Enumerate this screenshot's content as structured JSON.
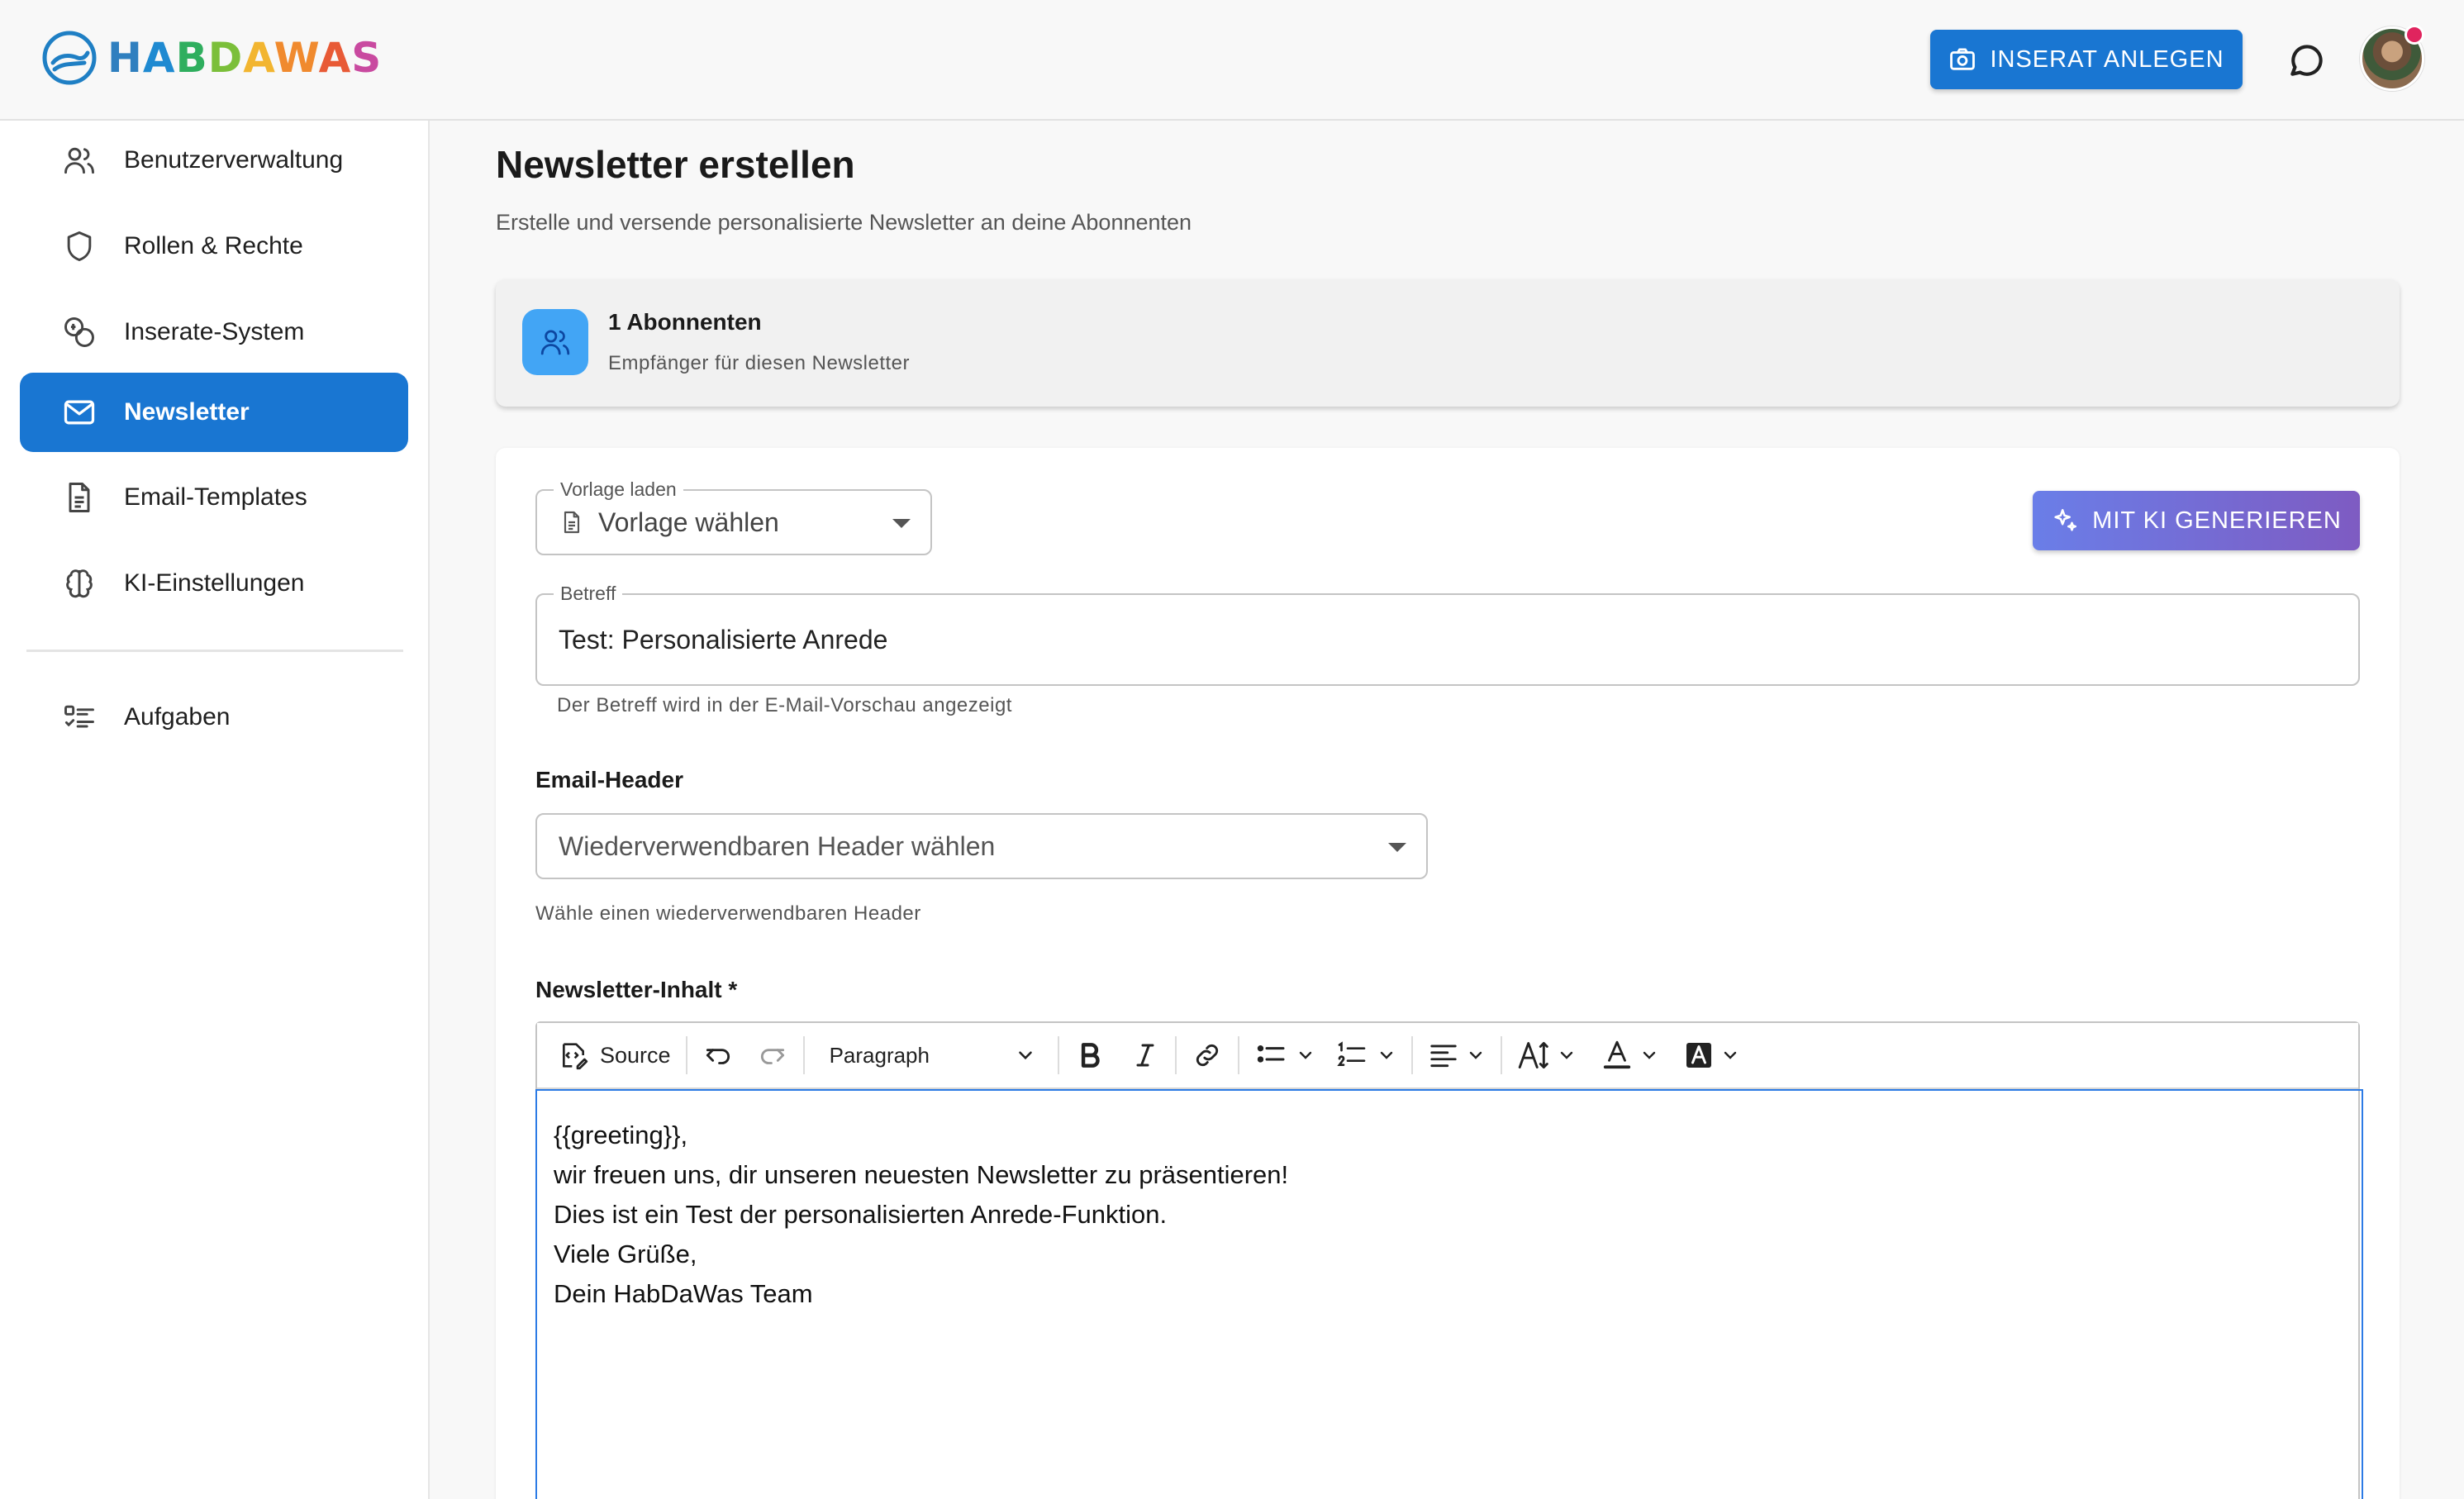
{
  "app": {
    "logo_text": "HABDAWAS",
    "create_button_label": "INSERAT ANLEGEN"
  },
  "sidebar": {
    "items": [
      {
        "label": "Benutzerverwaltung",
        "icon": "users-icon"
      },
      {
        "label": "Rollen & Rechte",
        "icon": "shield-icon"
      },
      {
        "label": "Inserate-System",
        "icon": "coins-icon"
      },
      {
        "label": "Newsletter",
        "icon": "mail-icon",
        "active": true
      },
      {
        "label": "Email-Templates",
        "icon": "document-icon"
      },
      {
        "label": "KI-Einstellungen",
        "icon": "brain-icon"
      },
      {
        "label": "Aufgaben",
        "icon": "task-list-icon"
      }
    ]
  },
  "page": {
    "title": "Newsletter erstellen",
    "subtitle": "Erstelle und versende personalisierte Newsletter an deine Abonnenten"
  },
  "subscribers": {
    "count_label": "1 Abonnenten",
    "description": "Empfänger für diesen Newsletter"
  },
  "form": {
    "template": {
      "label": "Vorlage laden",
      "value": "Vorlage wählen"
    },
    "ai_button_label": "MIT KI GENERIEREN",
    "subject": {
      "label": "Betreff",
      "value": "Test: Personalisierte Anrede",
      "helper": "Der Betreff wird in der E-Mail-Vorschau angezeigt"
    },
    "header": {
      "section_label": "Email-Header",
      "placeholder": "Wiederverwendbaren Header wählen",
      "helper": "Wähle einen wiederverwendbaren Header"
    },
    "content": {
      "section_label": "Newsletter-Inhalt *",
      "toolbar": {
        "source_label": "Source",
        "paragraph_label": "Paragraph"
      },
      "lines": [
        "{{greeting}},",
        "wir freuen uns, dir unseren neuesten Newsletter zu präsentieren!",
        "Dies ist ein Test der personalisierten Anrede-Funktion.",
        "Viele Grüße,",
        "Dein HabDaWas Team"
      ]
    }
  },
  "colors": {
    "primary": "#1976d2",
    "ai_gradient_start": "#6a7ee8",
    "ai_gradient_end": "#7e5bc2",
    "subscriber_icon_bg": "#42a5f5",
    "editor_focus": "#2c7be5"
  }
}
